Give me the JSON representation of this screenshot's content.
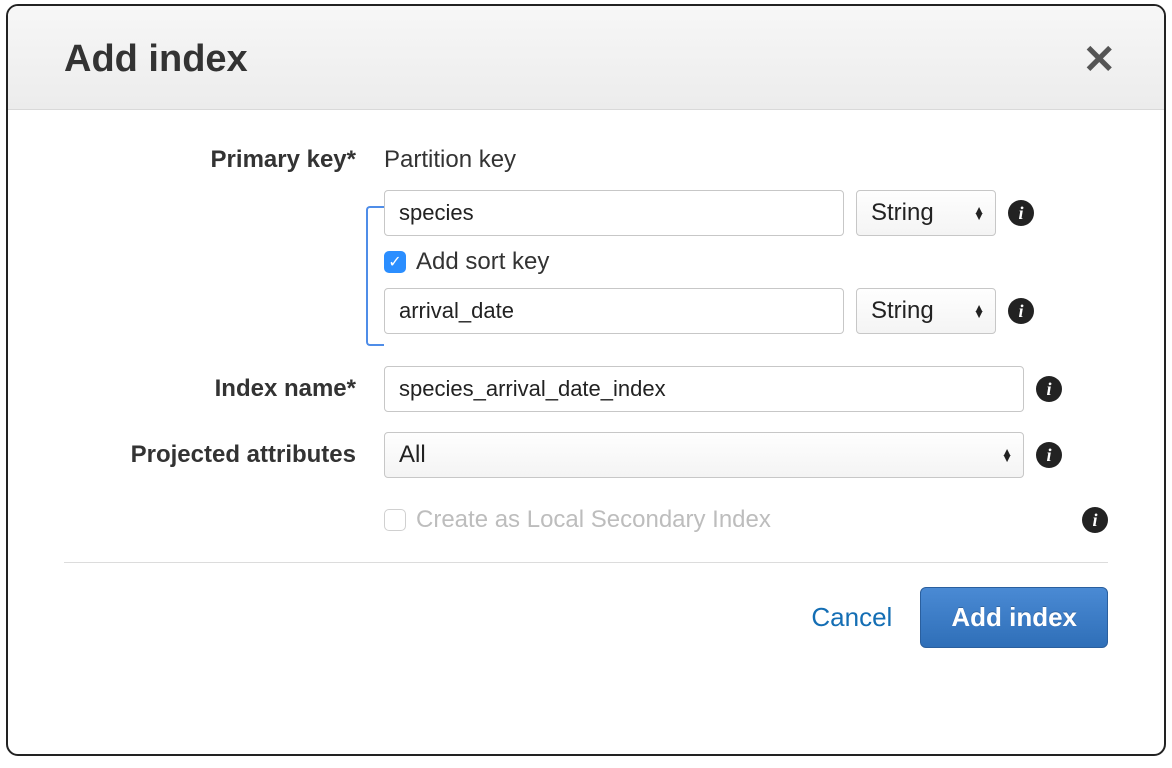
{
  "modal": {
    "title": "Add index",
    "close_glyph": "✕"
  },
  "form": {
    "primary_key": {
      "label": "Primary key*",
      "partition_label": "Partition key",
      "partition_value": "species",
      "partition_type": "String",
      "add_sort_key_label": "Add sort key",
      "add_sort_key_checked": true,
      "sort_value": "arrival_date",
      "sort_type": "String"
    },
    "index_name": {
      "label": "Index name*",
      "value": "species_arrival_date_index"
    },
    "projected_attributes": {
      "label": "Projected attributes",
      "value": "All"
    },
    "local_secondary": {
      "label": "Create as Local Secondary Index",
      "checked": false,
      "disabled": true
    }
  },
  "footer": {
    "cancel": "Cancel",
    "submit": "Add index"
  },
  "icons": {
    "info_glyph": "i",
    "check_glyph": "✓",
    "caret_up": "▲",
    "caret_down": "▼"
  }
}
